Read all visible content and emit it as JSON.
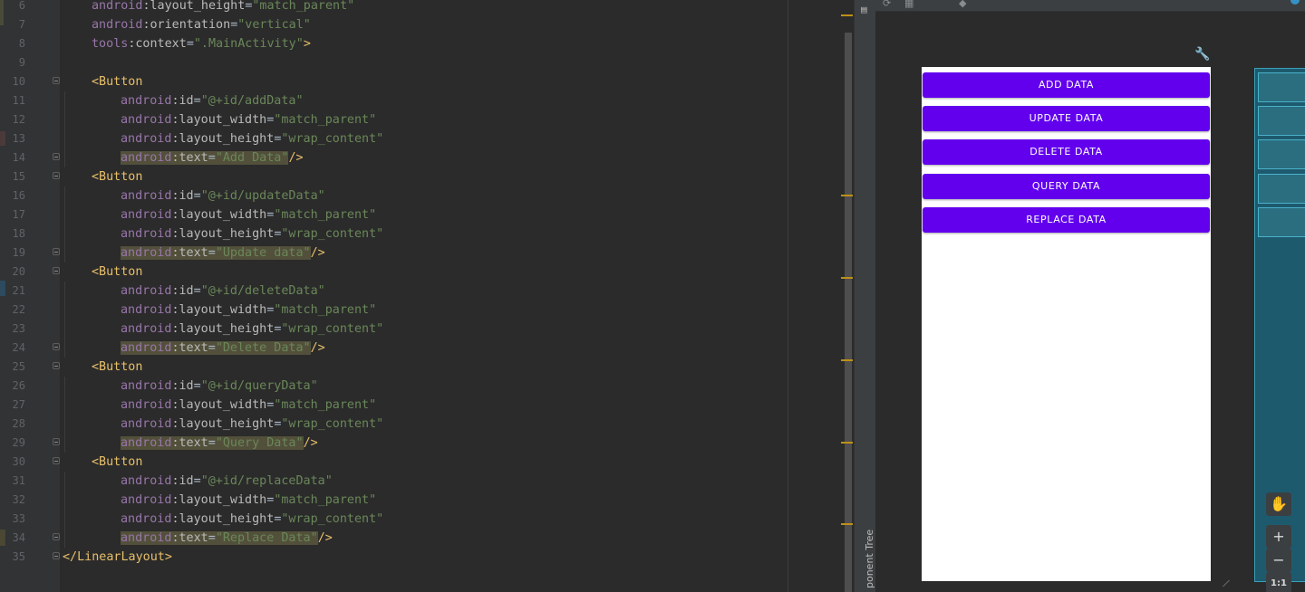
{
  "editor": {
    "lines": [
      {
        "num": "6",
        "indent": 1,
        "parts": [
          [
            "ns",
            "android"
          ],
          [
            "attr",
            ":layout_height"
          ],
          [
            "plain",
            "="
          ],
          [
            "val",
            "\"match_parent\""
          ]
        ]
      },
      {
        "num": "7",
        "indent": 1,
        "parts": [
          [
            "ns",
            "android"
          ],
          [
            "attr",
            ":orientation"
          ],
          [
            "plain",
            "="
          ],
          [
            "val",
            "\"vertical\""
          ]
        ]
      },
      {
        "num": "8",
        "indent": 1,
        "parts": [
          [
            "ns",
            "tools"
          ],
          [
            "attr",
            ":context"
          ],
          [
            "plain",
            "="
          ],
          [
            "val",
            "\".MainActivity\""
          ],
          [
            "tag",
            ">"
          ]
        ]
      },
      {
        "num": "9",
        "indent": 0,
        "parts": []
      },
      {
        "num": "10",
        "indent": 1,
        "fold": true,
        "parts": [
          [
            "tag",
            "<Button"
          ]
        ]
      },
      {
        "num": "11",
        "indent": 2,
        "parts": [
          [
            "ns",
            "android"
          ],
          [
            "attr",
            ":id"
          ],
          [
            "plain",
            "="
          ],
          [
            "val",
            "\"@+id/addData\""
          ]
        ]
      },
      {
        "num": "12",
        "indent": 2,
        "parts": [
          [
            "ns",
            "android"
          ],
          [
            "attr",
            ":layout_width"
          ],
          [
            "plain",
            "="
          ],
          [
            "val",
            "\"match_parent\""
          ]
        ]
      },
      {
        "num": "13",
        "indent": 2,
        "parts": [
          [
            "ns",
            "android"
          ],
          [
            "attr",
            ":layout_height"
          ],
          [
            "plain",
            "="
          ],
          [
            "val",
            "\"wrap_content\""
          ]
        ]
      },
      {
        "num": "14",
        "indent": 2,
        "fold": true,
        "parts": [
          [
            "ns hl",
            "android"
          ],
          [
            "attr hl",
            ":text"
          ],
          [
            "plain hl",
            "="
          ],
          [
            "val hl",
            "\"Add Data\""
          ],
          [
            "tag",
            "/>"
          ]
        ]
      },
      {
        "num": "15",
        "indent": 1,
        "fold": true,
        "parts": [
          [
            "tag",
            "<Button"
          ]
        ]
      },
      {
        "num": "16",
        "indent": 2,
        "parts": [
          [
            "ns",
            "android"
          ],
          [
            "attr",
            ":id"
          ],
          [
            "plain",
            "="
          ],
          [
            "val",
            "\"@+id/updateData\""
          ]
        ]
      },
      {
        "num": "17",
        "indent": 2,
        "parts": [
          [
            "ns",
            "android"
          ],
          [
            "attr",
            ":layout_width"
          ],
          [
            "plain",
            "="
          ],
          [
            "val",
            "\"match_parent\""
          ]
        ]
      },
      {
        "num": "18",
        "indent": 2,
        "parts": [
          [
            "ns",
            "android"
          ],
          [
            "attr",
            ":layout_height"
          ],
          [
            "plain",
            "="
          ],
          [
            "val",
            "\"wrap_content\""
          ]
        ]
      },
      {
        "num": "19",
        "indent": 2,
        "fold": true,
        "parts": [
          [
            "ns hl",
            "android"
          ],
          [
            "attr hl",
            ":text"
          ],
          [
            "plain hl",
            "="
          ],
          [
            "val hl",
            "\"Update data\""
          ],
          [
            "tag",
            "/>"
          ]
        ]
      },
      {
        "num": "20",
        "indent": 1,
        "fold": true,
        "parts": [
          [
            "tag",
            "<Button"
          ]
        ]
      },
      {
        "num": "21",
        "indent": 2,
        "parts": [
          [
            "ns",
            "android"
          ],
          [
            "attr",
            ":id"
          ],
          [
            "plain",
            "="
          ],
          [
            "val",
            "\"@+id/deleteData\""
          ]
        ]
      },
      {
        "num": "22",
        "indent": 2,
        "parts": [
          [
            "ns",
            "android"
          ],
          [
            "attr",
            ":layout_width"
          ],
          [
            "plain",
            "="
          ],
          [
            "val",
            "\"match_parent\""
          ]
        ]
      },
      {
        "num": "23",
        "indent": 2,
        "parts": [
          [
            "ns",
            "android"
          ],
          [
            "attr",
            ":layout_height"
          ],
          [
            "plain",
            "="
          ],
          [
            "val",
            "\"wrap_content\""
          ]
        ]
      },
      {
        "num": "24",
        "indent": 2,
        "fold": true,
        "parts": [
          [
            "ns hl",
            "android"
          ],
          [
            "attr hl",
            ":text"
          ],
          [
            "plain hl",
            "="
          ],
          [
            "val hl",
            "\"Delete Data\""
          ],
          [
            "tag",
            "/>"
          ]
        ]
      },
      {
        "num": "25",
        "indent": 1,
        "fold": true,
        "parts": [
          [
            "tag",
            "<Button"
          ]
        ]
      },
      {
        "num": "26",
        "indent": 2,
        "parts": [
          [
            "ns",
            "android"
          ],
          [
            "attr",
            ":id"
          ],
          [
            "plain",
            "="
          ],
          [
            "val",
            "\"@+id/queryData\""
          ]
        ]
      },
      {
        "num": "27",
        "indent": 2,
        "parts": [
          [
            "ns",
            "android"
          ],
          [
            "attr",
            ":layout_width"
          ],
          [
            "plain",
            "="
          ],
          [
            "val",
            "\"match_parent\""
          ]
        ]
      },
      {
        "num": "28",
        "indent": 2,
        "parts": [
          [
            "ns",
            "android"
          ],
          [
            "attr",
            ":layout_height"
          ],
          [
            "plain",
            "="
          ],
          [
            "val",
            "\"wrap_content\""
          ]
        ]
      },
      {
        "num": "29",
        "indent": 2,
        "fold": true,
        "parts": [
          [
            "ns hl",
            "android"
          ],
          [
            "attr hl",
            ":text"
          ],
          [
            "plain hl",
            "="
          ],
          [
            "val hl",
            "\"Query Data\""
          ],
          [
            "tag",
            "/>"
          ]
        ]
      },
      {
        "num": "30",
        "indent": 1,
        "fold": true,
        "parts": [
          [
            "tag",
            "<Button"
          ]
        ]
      },
      {
        "num": "31",
        "indent": 2,
        "parts": [
          [
            "ns",
            "android"
          ],
          [
            "attr",
            ":id"
          ],
          [
            "plain",
            "="
          ],
          [
            "val",
            "\"@+id/replaceData\""
          ]
        ]
      },
      {
        "num": "32",
        "indent": 2,
        "parts": [
          [
            "ns",
            "android"
          ],
          [
            "attr",
            ":layout_width"
          ],
          [
            "plain",
            "="
          ],
          [
            "val",
            "\"match_parent\""
          ]
        ]
      },
      {
        "num": "33",
        "indent": 2,
        "parts": [
          [
            "ns",
            "android"
          ],
          [
            "attr",
            ":layout_height"
          ],
          [
            "plain",
            "="
          ],
          [
            "val",
            "\"wrap_content\""
          ]
        ]
      },
      {
        "num": "34",
        "indent": 2,
        "fold": true,
        "parts": [
          [
            "ns hl",
            "android"
          ],
          [
            "attr hl",
            ":text"
          ],
          [
            "plain hl",
            "="
          ],
          [
            "val hl",
            "\"Replace Data\""
          ],
          [
            "tag",
            "/>"
          ]
        ]
      },
      {
        "num": "35",
        "indent": 0,
        "fold": true,
        "parts": [
          [
            "tag",
            "</LinearLayout>"
          ]
        ]
      }
    ]
  },
  "side_panel": {
    "component_tree_label": "ponent Tree"
  },
  "preview": {
    "buttons": [
      "ADD DATA",
      "UPDATE DATA",
      "DELETE DATA",
      "QUERY DATA",
      "REPLACE DATA"
    ],
    "button_color": "#6200ee",
    "zoom": {
      "plus": "+",
      "minus": "−",
      "ratio": "1:1"
    }
  },
  "colors": {
    "editor_bg": "#2b2b2b",
    "gutter_bg": "#313335",
    "tag": "#e8bf6a",
    "namespace": "#9876aa",
    "string": "#6a8759",
    "highlight": "#52503a"
  }
}
